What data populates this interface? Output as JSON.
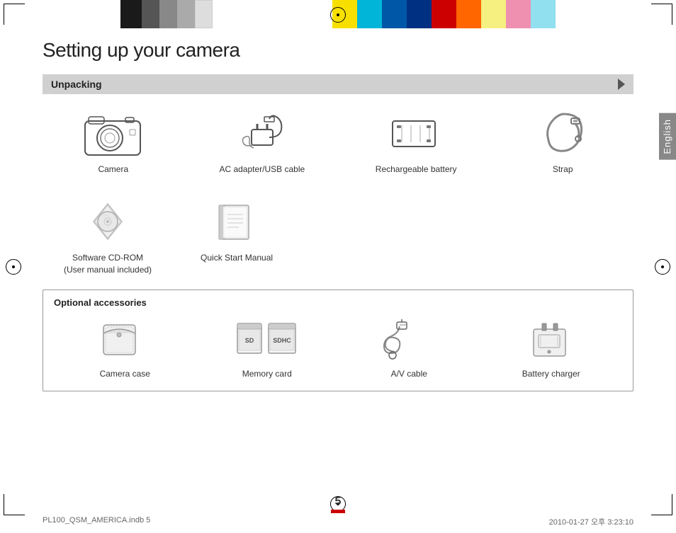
{
  "page": {
    "title": "Setting up your camera",
    "page_number": "5",
    "footer_left": "PL100_QSM_AMERICA.indb   5",
    "footer_right": "2010-01-27   오후 3:23:10"
  },
  "unpacking": {
    "section_title": "Unpacking",
    "items": [
      {
        "label": "Camera",
        "id": "camera"
      },
      {
        "label": "AC adapter/USB cable",
        "id": "ac-adapter"
      },
      {
        "label": "Rechargeable battery",
        "id": "battery"
      },
      {
        "label": "Strap",
        "id": "strap"
      },
      {
        "label": "Software CD-ROM\n(User manual included)",
        "id": "cd-rom"
      },
      {
        "label": "Quick Start Manual",
        "id": "manual"
      }
    ]
  },
  "optional": {
    "section_title": "Optional accessories",
    "items": [
      {
        "label": "Camera case",
        "id": "camera-case"
      },
      {
        "label": "Memory card",
        "id": "memory-card"
      },
      {
        "label": "A/V cable",
        "id": "av-cable"
      },
      {
        "label": "Battery charger",
        "id": "battery-charger"
      }
    ]
  },
  "sidebar": {
    "language": "English"
  }
}
